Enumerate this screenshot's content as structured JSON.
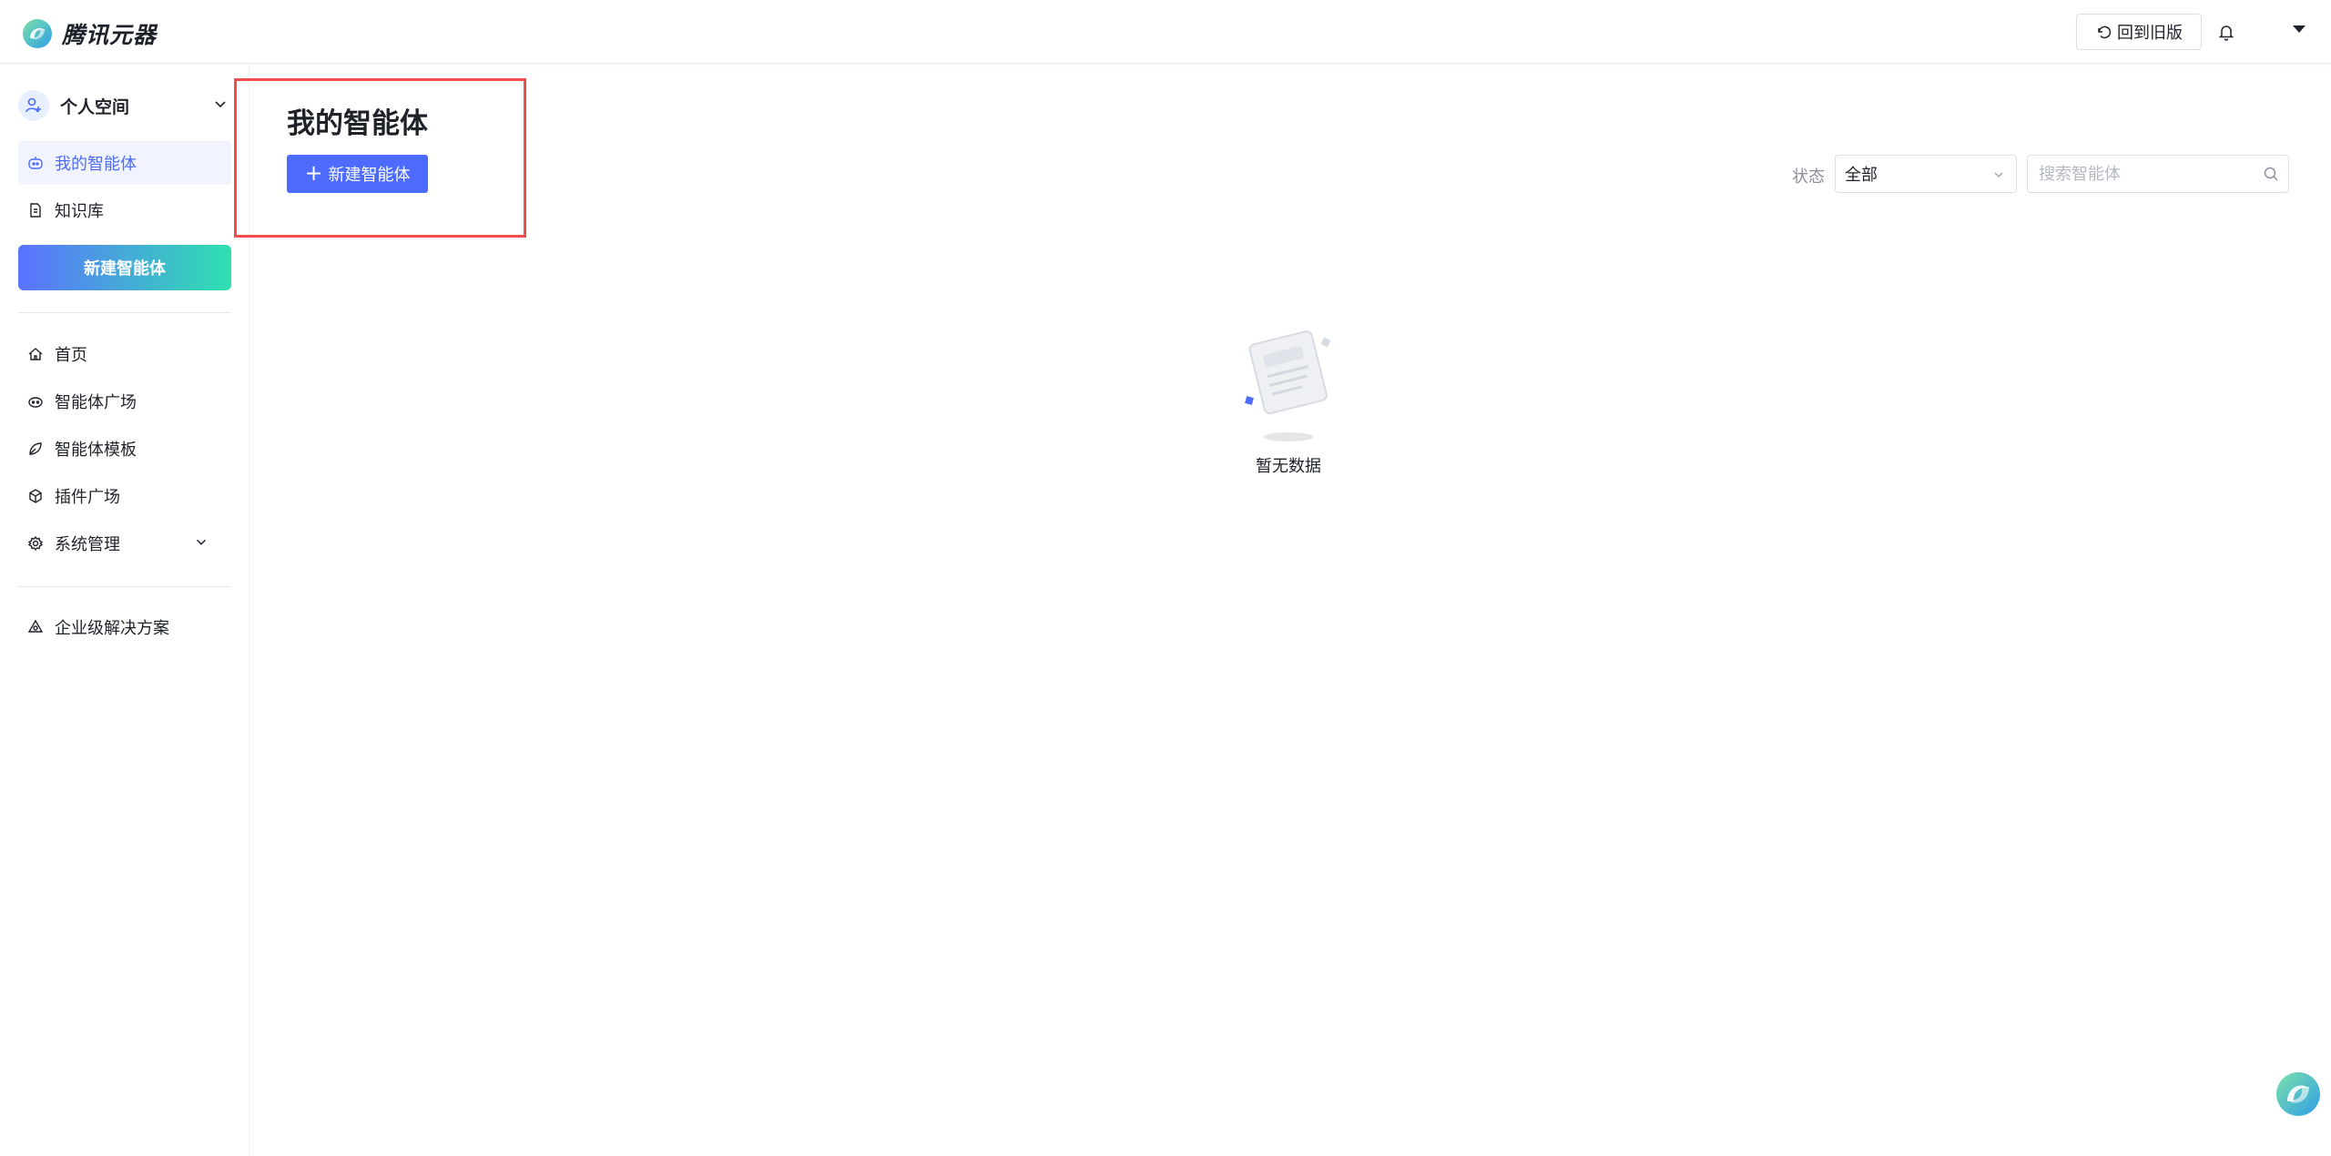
{
  "header": {
    "app_name": "腾讯元器",
    "old_version_label": "回到旧版"
  },
  "sidebar": {
    "space_label": "个人空间",
    "items_top": [
      {
        "label": "我的智能体",
        "icon": "agent-icon",
        "active": true
      },
      {
        "label": "知识库",
        "icon": "document-icon",
        "active": false
      }
    ],
    "new_agent_label": "新建智能体",
    "items_main": [
      {
        "label": "首页",
        "icon": "home-icon"
      },
      {
        "label": "智能体广场",
        "icon": "agent-square-icon"
      },
      {
        "label": "智能体模板",
        "icon": "template-icon"
      },
      {
        "label": "插件广场",
        "icon": "plugin-icon"
      },
      {
        "label": "系统管理",
        "icon": "settings-icon"
      }
    ],
    "items_bottom": [
      {
        "label": "企业级解决方案",
        "icon": "enterprise-icon"
      }
    ]
  },
  "main": {
    "title": "我的智能体",
    "new_agent_button": "新建智能体",
    "filter": {
      "status_label": "状态",
      "status_value": "全部"
    },
    "search_placeholder": "搜索智能体",
    "empty_text": "暂无数据"
  },
  "colors": {
    "primary": "#4d6bfe",
    "highlight_border": "#f04d4d",
    "gradient_start": "#5b72ff",
    "gradient_end": "#2fe0b0"
  }
}
